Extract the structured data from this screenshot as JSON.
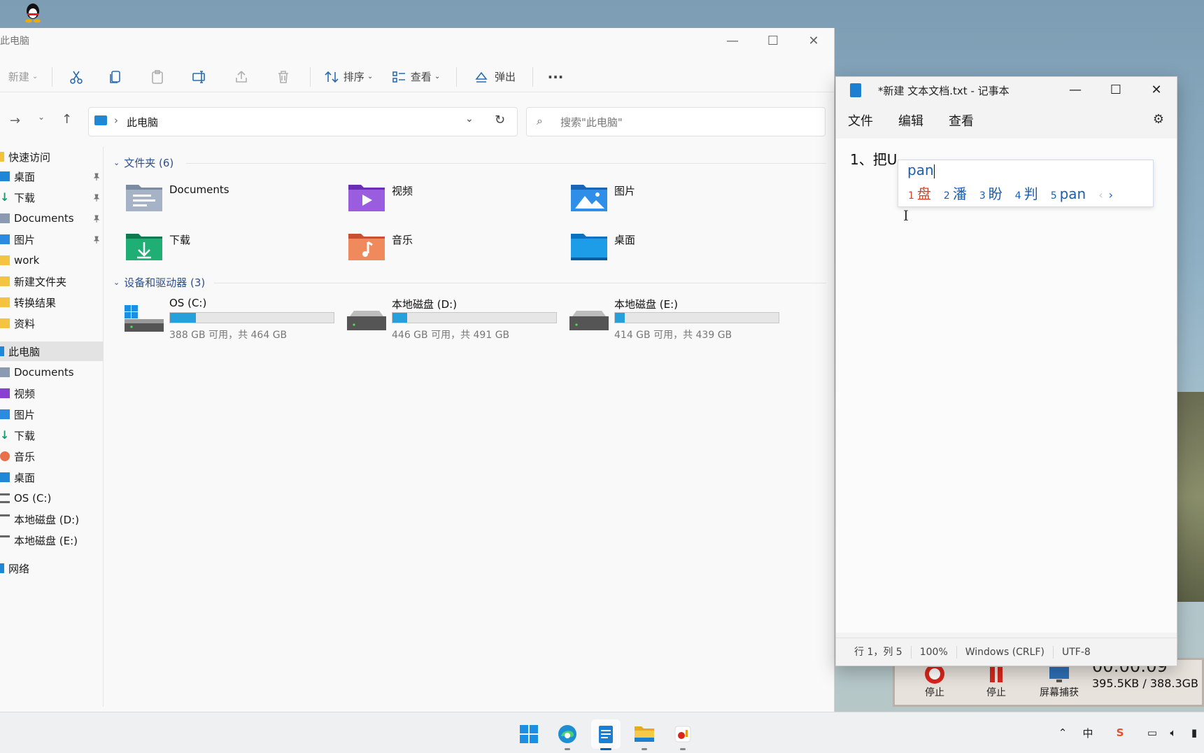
{
  "explorer": {
    "title": "此电脑",
    "toolbar": {
      "new_label": "新建",
      "sort_label": "排序",
      "view_label": "查看",
      "eject_label": "弹出",
      "more_label": "···"
    },
    "address": {
      "location": "此电脑"
    },
    "search": {
      "placeholder": "搜索\"此电脑\""
    },
    "sidebar": {
      "quick_access": "快速访问",
      "items": [
        {
          "label": "桌面",
          "icon": "desktop-icon",
          "pinned": true
        },
        {
          "label": "下载",
          "icon": "download-icon",
          "pinned": true
        },
        {
          "label": "Documents",
          "icon": "documents-icon",
          "pinned": true
        },
        {
          "label": "图片",
          "icon": "pictures-icon",
          "pinned": true
        },
        {
          "label": "work",
          "icon": "folder-icon"
        },
        {
          "label": "新建文件夹",
          "icon": "folder-icon"
        },
        {
          "label": "转换结果",
          "icon": "folder-icon"
        },
        {
          "label": "资料",
          "icon": "folder-icon"
        }
      ],
      "this_pc": "此电脑",
      "pc_items": [
        {
          "label": "Documents",
          "icon": "documents-icon"
        },
        {
          "label": "视频",
          "icon": "videos-icon"
        },
        {
          "label": "图片",
          "icon": "pictures-icon"
        },
        {
          "label": "下载",
          "icon": "download-icon"
        },
        {
          "label": "音乐",
          "icon": "music-icon"
        },
        {
          "label": "桌面",
          "icon": "desktop-icon"
        },
        {
          "label": "OS (C:)",
          "icon": "drive-icon"
        },
        {
          "label": "本地磁盘 (D:)",
          "icon": "drive-icon"
        },
        {
          "label": "本地磁盘 (E:)",
          "icon": "drive-icon"
        }
      ],
      "network": "网络"
    },
    "folders_header": "文件夹 (6)",
    "folders": [
      {
        "label": "Documents",
        "icon": "documents-folder-icon"
      },
      {
        "label": "视频",
        "icon": "videos-folder-icon"
      },
      {
        "label": "图片",
        "icon": "pictures-folder-icon"
      },
      {
        "label": "下载",
        "icon": "downloads-folder-icon"
      },
      {
        "label": "音乐",
        "icon": "music-folder-icon"
      },
      {
        "label": "桌面",
        "icon": "desktop-folder-icon"
      }
    ],
    "drives_header": "设备和驱动器 (3)",
    "drives": [
      {
        "name": "OS (C:)",
        "size": "388 GB 可用，共 464 GB",
        "used_fraction": 0.16
      },
      {
        "name": "本地磁盘 (D:)",
        "size": "446 GB 可用，共 491 GB",
        "used_fraction": 0.09
      },
      {
        "name": "本地磁盘 (E:)",
        "size": "414 GB 可用，共 439 GB",
        "used_fraction": 0.06
      }
    ]
  },
  "notepad": {
    "title": "*新建 文本文档.txt - 记事本",
    "menu": [
      "文件",
      "编辑",
      "查看"
    ],
    "content": "1、把U",
    "ime": {
      "input": "pan",
      "candidates": [
        {
          "num": "1",
          "text": "盘"
        },
        {
          "num": "2",
          "text": "潘"
        },
        {
          "num": "3",
          "text": "盼"
        },
        {
          "num": "4",
          "text": "判"
        },
        {
          "num": "5",
          "text": "pan"
        }
      ]
    },
    "status": {
      "position": "行 1，列 5",
      "zoom": "100%",
      "line_ending": "Windows (CRLF)",
      "encoding": "UTF-8"
    }
  },
  "recorder": {
    "stop1": "停止",
    "stop2": "停止",
    "capture": "屏幕捕获",
    "time": "00:00:09",
    "size": "395.5KB / 388.3GB"
  },
  "colors": {
    "accent": "#005fb8",
    "drive_bar": "#26a0da",
    "ime_highlight": "#d0452b",
    "ime_text": "#1b5faf"
  }
}
